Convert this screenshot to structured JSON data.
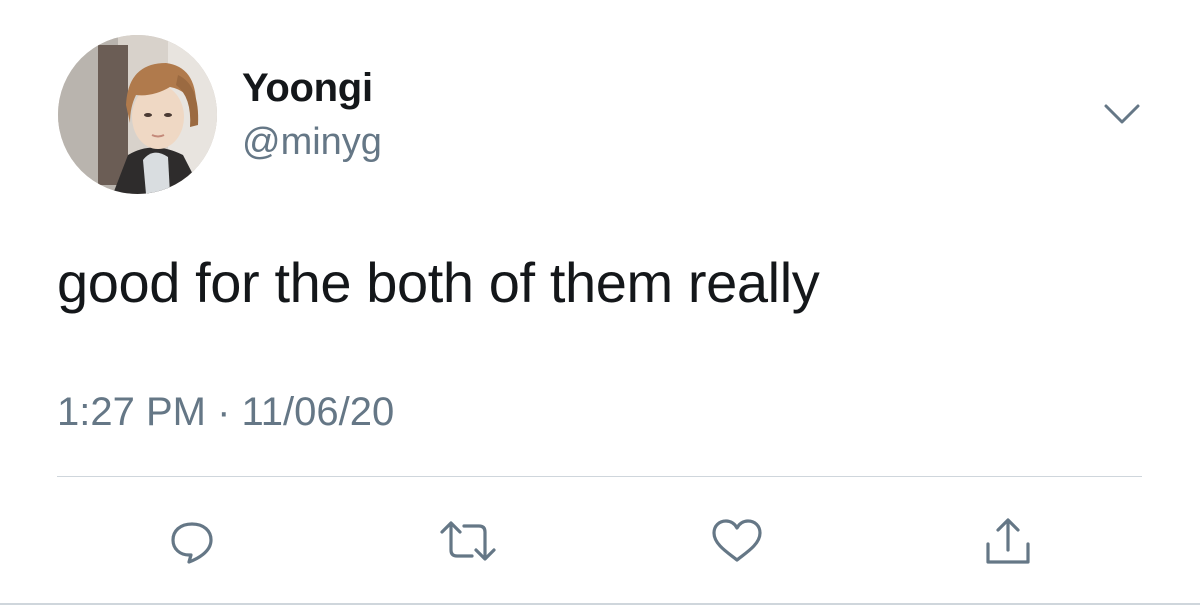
{
  "tweet": {
    "author": {
      "display_name": "Yoongi",
      "handle": "@minyg",
      "avatar_icon": "profile-photo"
    },
    "text": "good for the both of them really",
    "timestamp": "1:27 PM · 11/06/20",
    "menu_icon": "chevron-down-icon",
    "actions": [
      {
        "name": "reply",
        "icon": "speech-bubble-icon"
      },
      {
        "name": "retweet",
        "icon": "retweet-arrows-icon"
      },
      {
        "name": "like",
        "icon": "heart-icon"
      },
      {
        "name": "share",
        "icon": "share-upload-icon"
      }
    ]
  },
  "colors": {
    "text_primary": "#14171a",
    "text_secondary": "#657786",
    "icon": "#657786",
    "divider": "#cfd6dc"
  }
}
